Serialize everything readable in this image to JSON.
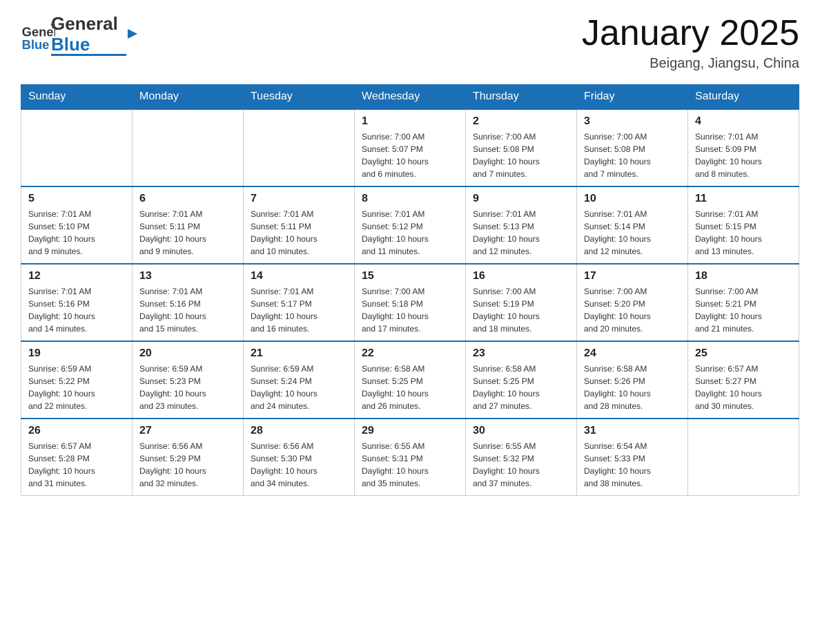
{
  "header": {
    "logo_general": "General",
    "logo_blue": "Blue",
    "title": "January 2025",
    "subtitle": "Beigang, Jiangsu, China"
  },
  "days_of_week": [
    "Sunday",
    "Monday",
    "Tuesday",
    "Wednesday",
    "Thursday",
    "Friday",
    "Saturday"
  ],
  "weeks": [
    [
      {
        "day": "",
        "info": ""
      },
      {
        "day": "",
        "info": ""
      },
      {
        "day": "",
        "info": ""
      },
      {
        "day": "1",
        "info": "Sunrise: 7:00 AM\nSunset: 5:07 PM\nDaylight: 10 hours\nand 6 minutes."
      },
      {
        "day": "2",
        "info": "Sunrise: 7:00 AM\nSunset: 5:08 PM\nDaylight: 10 hours\nand 7 minutes."
      },
      {
        "day": "3",
        "info": "Sunrise: 7:00 AM\nSunset: 5:08 PM\nDaylight: 10 hours\nand 7 minutes."
      },
      {
        "day": "4",
        "info": "Sunrise: 7:01 AM\nSunset: 5:09 PM\nDaylight: 10 hours\nand 8 minutes."
      }
    ],
    [
      {
        "day": "5",
        "info": "Sunrise: 7:01 AM\nSunset: 5:10 PM\nDaylight: 10 hours\nand 9 minutes."
      },
      {
        "day": "6",
        "info": "Sunrise: 7:01 AM\nSunset: 5:11 PM\nDaylight: 10 hours\nand 9 minutes."
      },
      {
        "day": "7",
        "info": "Sunrise: 7:01 AM\nSunset: 5:11 PM\nDaylight: 10 hours\nand 10 minutes."
      },
      {
        "day": "8",
        "info": "Sunrise: 7:01 AM\nSunset: 5:12 PM\nDaylight: 10 hours\nand 11 minutes."
      },
      {
        "day": "9",
        "info": "Sunrise: 7:01 AM\nSunset: 5:13 PM\nDaylight: 10 hours\nand 12 minutes."
      },
      {
        "day": "10",
        "info": "Sunrise: 7:01 AM\nSunset: 5:14 PM\nDaylight: 10 hours\nand 12 minutes."
      },
      {
        "day": "11",
        "info": "Sunrise: 7:01 AM\nSunset: 5:15 PM\nDaylight: 10 hours\nand 13 minutes."
      }
    ],
    [
      {
        "day": "12",
        "info": "Sunrise: 7:01 AM\nSunset: 5:16 PM\nDaylight: 10 hours\nand 14 minutes."
      },
      {
        "day": "13",
        "info": "Sunrise: 7:01 AM\nSunset: 5:16 PM\nDaylight: 10 hours\nand 15 minutes."
      },
      {
        "day": "14",
        "info": "Sunrise: 7:01 AM\nSunset: 5:17 PM\nDaylight: 10 hours\nand 16 minutes."
      },
      {
        "day": "15",
        "info": "Sunrise: 7:00 AM\nSunset: 5:18 PM\nDaylight: 10 hours\nand 17 minutes."
      },
      {
        "day": "16",
        "info": "Sunrise: 7:00 AM\nSunset: 5:19 PM\nDaylight: 10 hours\nand 18 minutes."
      },
      {
        "day": "17",
        "info": "Sunrise: 7:00 AM\nSunset: 5:20 PM\nDaylight: 10 hours\nand 20 minutes."
      },
      {
        "day": "18",
        "info": "Sunrise: 7:00 AM\nSunset: 5:21 PM\nDaylight: 10 hours\nand 21 minutes."
      }
    ],
    [
      {
        "day": "19",
        "info": "Sunrise: 6:59 AM\nSunset: 5:22 PM\nDaylight: 10 hours\nand 22 minutes."
      },
      {
        "day": "20",
        "info": "Sunrise: 6:59 AM\nSunset: 5:23 PM\nDaylight: 10 hours\nand 23 minutes."
      },
      {
        "day": "21",
        "info": "Sunrise: 6:59 AM\nSunset: 5:24 PM\nDaylight: 10 hours\nand 24 minutes."
      },
      {
        "day": "22",
        "info": "Sunrise: 6:58 AM\nSunset: 5:25 PM\nDaylight: 10 hours\nand 26 minutes."
      },
      {
        "day": "23",
        "info": "Sunrise: 6:58 AM\nSunset: 5:25 PM\nDaylight: 10 hours\nand 27 minutes."
      },
      {
        "day": "24",
        "info": "Sunrise: 6:58 AM\nSunset: 5:26 PM\nDaylight: 10 hours\nand 28 minutes."
      },
      {
        "day": "25",
        "info": "Sunrise: 6:57 AM\nSunset: 5:27 PM\nDaylight: 10 hours\nand 30 minutes."
      }
    ],
    [
      {
        "day": "26",
        "info": "Sunrise: 6:57 AM\nSunset: 5:28 PM\nDaylight: 10 hours\nand 31 minutes."
      },
      {
        "day": "27",
        "info": "Sunrise: 6:56 AM\nSunset: 5:29 PM\nDaylight: 10 hours\nand 32 minutes."
      },
      {
        "day": "28",
        "info": "Sunrise: 6:56 AM\nSunset: 5:30 PM\nDaylight: 10 hours\nand 34 minutes."
      },
      {
        "day": "29",
        "info": "Sunrise: 6:55 AM\nSunset: 5:31 PM\nDaylight: 10 hours\nand 35 minutes."
      },
      {
        "day": "30",
        "info": "Sunrise: 6:55 AM\nSunset: 5:32 PM\nDaylight: 10 hours\nand 37 minutes."
      },
      {
        "day": "31",
        "info": "Sunrise: 6:54 AM\nSunset: 5:33 PM\nDaylight: 10 hours\nand 38 minutes."
      },
      {
        "day": "",
        "info": ""
      }
    ]
  ]
}
